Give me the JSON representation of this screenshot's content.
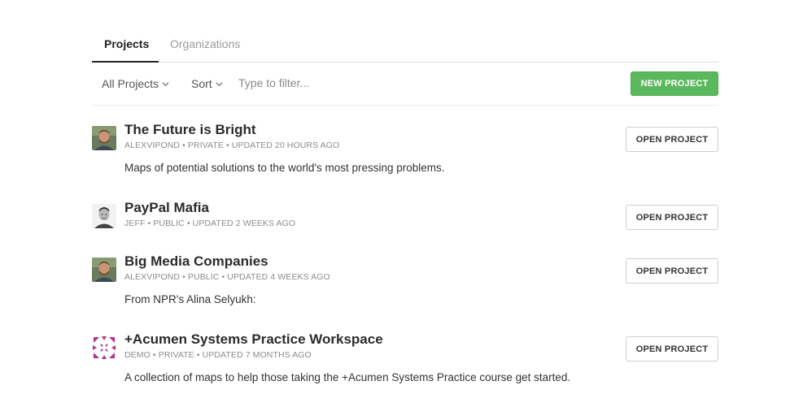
{
  "tabs": {
    "projects": "Projects",
    "organizations": "Organizations"
  },
  "toolbar": {
    "all_projects": "All Projects",
    "sort": "Sort",
    "filter_placeholder": "Type to filter...",
    "new_project": "NEW PROJECT"
  },
  "projects": [
    {
      "title": "The Future is Bright",
      "meta": "ALEXVIPOND • PRIVATE • UPDATED 20 HOURS AGO",
      "description": "Maps of potential solutions to the world's most pressing problems.",
      "button": "OPEN PROJECT",
      "avatar": "user-photo"
    },
    {
      "title": "PayPal Mafia",
      "meta": "JEFF • PUBLIC • UPDATED 2 WEEKS AGO",
      "description": "",
      "button": "OPEN PROJECT",
      "avatar": "user-photo"
    },
    {
      "title": "Big Media Companies",
      "meta": "ALEXVIPOND • PUBLIC • UPDATED 4 WEEKS AGO",
      "description": "From NPR's Alina Selyukh:",
      "button": "OPEN PROJECT",
      "avatar": "user-photo"
    },
    {
      "title": "+Acumen Systems Practice Workspace",
      "meta": "DEMO • PRIVATE • UPDATED 7 MONTHS AGO",
      "description": "A collection of maps to help those taking the +Acumen Systems Practice course get started.",
      "button": "OPEN PROJECT",
      "avatar": "acumen-logo"
    }
  ],
  "colors": {
    "accent_green": "#5cb85c",
    "logo_magenta": "#b0338f"
  }
}
